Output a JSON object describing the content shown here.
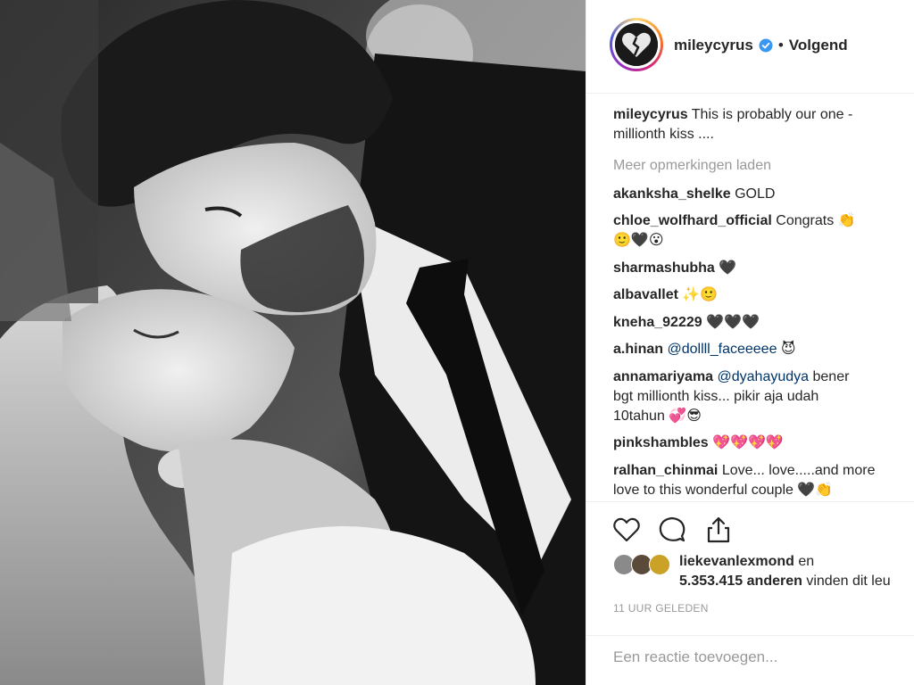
{
  "post": {
    "username": "mileycyrus",
    "verified": true,
    "separator": "•",
    "follow_label": "Volgend",
    "caption": {
      "user": "mileycyrus",
      "text_line1": "This is probably our one -",
      "text_line2": "millionth kiss ...."
    },
    "load_more_label": "Meer opmerkingen laden",
    "comments": [
      {
        "user": "akanksha_shelke",
        "text": "GOLD"
      },
      {
        "user": "chloe_wolfhard_official",
        "text": "Congrats 👏",
        "text2": "🙂🖤😮"
      },
      {
        "user": "sharmashubha",
        "text": "🖤"
      },
      {
        "user": "albavallet",
        "text": "✨🙂"
      },
      {
        "user": "kneha_92229",
        "text": "🖤🖤🖤"
      },
      {
        "user": "a.hinan",
        "mention": "@dollll_faceeeee",
        "text": "😈"
      },
      {
        "user": "annamariyama",
        "mention": "@dyahayudya",
        "text": "bener",
        "text2": "bgt millionth kiss... pikir aja udah",
        "text3": "10tahun 💞😎"
      },
      {
        "user": "pinkshambles",
        "text": "💖💖💖💖"
      },
      {
        "user": "ralhan_chinmai",
        "text": "Love... love.....and more",
        "text2": "love to this wonderful couple 🖤👏"
      }
    ],
    "likes": {
      "first_user": "liekevanlexmond",
      "connector": "en",
      "count": "5.353.415",
      "others_label": "anderen",
      "suffix": "vinden dit leu"
    },
    "timestamp": "11 UUR GELEDEN",
    "comment_placeholder": "Een reactie toevoegen...",
    "icons": [
      "heart-icon",
      "comment-icon",
      "share-icon",
      "verified-badge-icon"
    ],
    "colors": {
      "accent_blue": "#3897f0",
      "mention": "#003569",
      "muted": "#999999",
      "text": "#262626"
    }
  }
}
